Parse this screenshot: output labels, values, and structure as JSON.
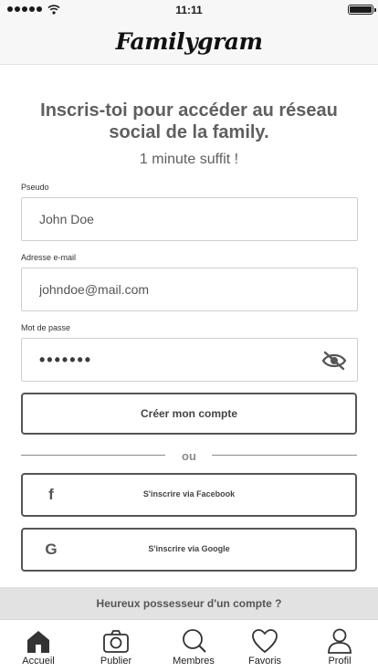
{
  "status_bar": {
    "time": "11:11"
  },
  "header": {
    "logo_text": "Familygram"
  },
  "intro": {
    "headline": "Inscris-toi pour accéder au réseau social de la family.",
    "subline": "1 minute suffit !"
  },
  "form": {
    "pseudo": {
      "label": "Pseudo",
      "value": "John Doe"
    },
    "email": {
      "label": "Adresse e-mail",
      "value": "johndoe@mail.com"
    },
    "password": {
      "label": "Mot de passe",
      "value": "•••••••"
    },
    "submit_label": "Créer mon compte"
  },
  "divider_text": "ou",
  "social": {
    "facebook_label": "S'inscrire via Facebook",
    "facebook_icon": "f",
    "google_label": "S'inscrire via Google",
    "google_icon": "G"
  },
  "login_banner": "Heureux possesseur d'un compte ?",
  "tabs": [
    {
      "label": "Accueil",
      "icon": "home-icon"
    },
    {
      "label": "Publier",
      "icon": "camera-icon"
    },
    {
      "label": "Membres",
      "icon": "search-icon"
    },
    {
      "label": "Favoris",
      "icon": "heart-icon"
    },
    {
      "label": "Profil",
      "icon": "user-icon"
    }
  ]
}
